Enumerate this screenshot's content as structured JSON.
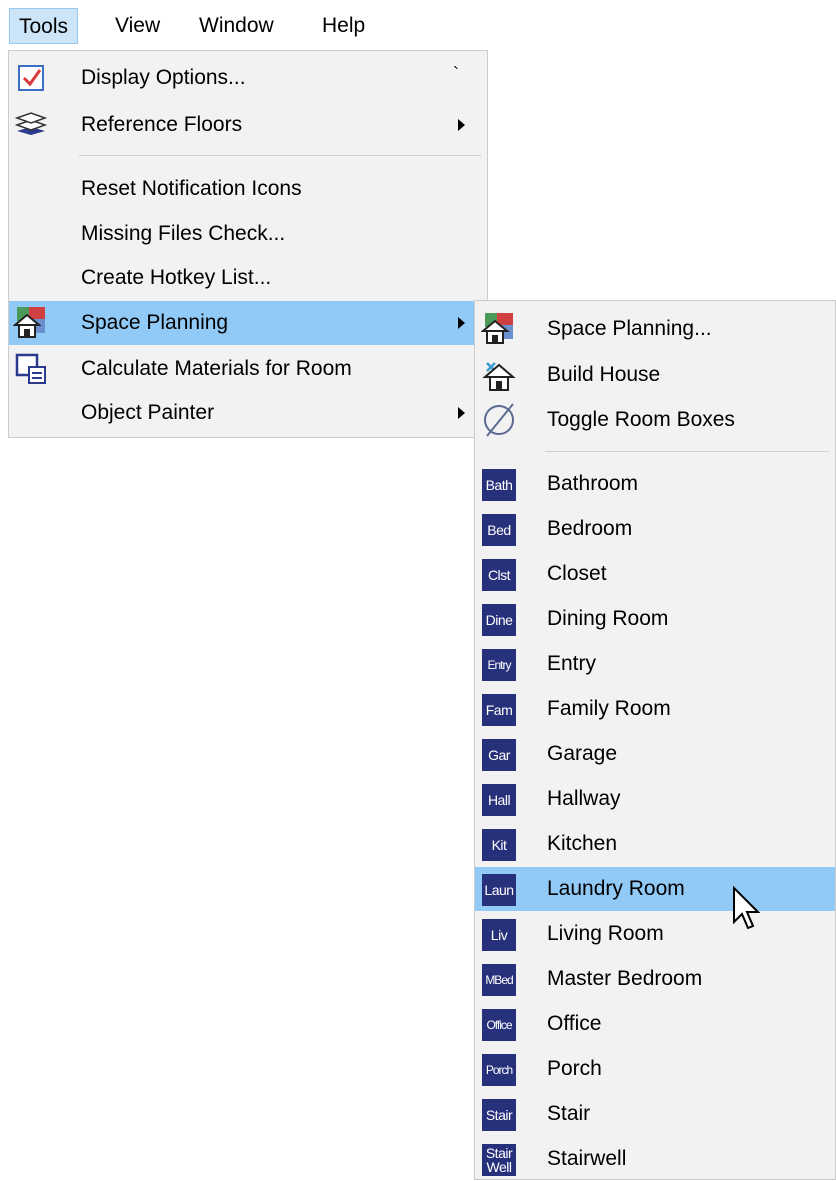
{
  "menubar": {
    "items": [
      {
        "label": "Tools",
        "active": true
      },
      {
        "label": "View"
      },
      {
        "label": "Window"
      },
      {
        "label": "Help"
      }
    ]
  },
  "tools_menu": {
    "items": [
      {
        "label": "Display Options...",
        "accel": "`",
        "icon": "checkbox-icon"
      },
      {
        "label": "Reference Floors",
        "submenu": true,
        "icon": "layers-icon"
      },
      {
        "label": "Reset Notification Icons"
      },
      {
        "label": "Missing Files Check..."
      },
      {
        "label": "Create Hotkey List..."
      },
      {
        "label": "Space Planning",
        "submenu": true,
        "highlighted": true,
        "icon": "space-planning-icon"
      },
      {
        "label": "Calculate Materials for Room",
        "icon": "calculate-materials-icon"
      },
      {
        "label": "Object Painter",
        "submenu": true
      }
    ]
  },
  "space_planning_menu": {
    "top_items": [
      {
        "label": "Space Planning...",
        "icon": "space-planning-icon"
      },
      {
        "label": "Build House",
        "icon": "build-house-icon"
      },
      {
        "label": "Toggle Room Boxes",
        "icon": "toggle-room-boxes-icon"
      }
    ],
    "rooms": [
      {
        "badge": "Bath",
        "label": "Bathroom"
      },
      {
        "badge": "Bed",
        "label": "Bedroom"
      },
      {
        "badge": "Clst",
        "label": "Closet"
      },
      {
        "badge": "Dine",
        "label": "Dining Room"
      },
      {
        "badge": "Entry",
        "label": "Entry"
      },
      {
        "badge": "Fam",
        "label": "Family Room"
      },
      {
        "badge": "Gar",
        "label": "Garage"
      },
      {
        "badge": "Hall",
        "label": "Hallway"
      },
      {
        "badge": "Kit",
        "label": "Kitchen"
      },
      {
        "badge": "Laun",
        "label": "Laundry Room",
        "highlighted": true
      },
      {
        "badge": "Liv",
        "label": "Living Room"
      },
      {
        "badge": "MBed",
        "label": "Master Bedroom"
      },
      {
        "badge": "Office",
        "label": "Office"
      },
      {
        "badge": "Porch",
        "label": "Porch"
      },
      {
        "badge": "Stair",
        "label": "Stair"
      },
      {
        "badge_line1": "Stair",
        "badge_line2": "Well",
        "label": "Stairwell"
      }
    ]
  },
  "colors": {
    "highlight": "#91c9f7",
    "menu_bg": "#f2f2f2",
    "badge_bg": "#27307a",
    "menubar_active": "#cce4f7"
  }
}
